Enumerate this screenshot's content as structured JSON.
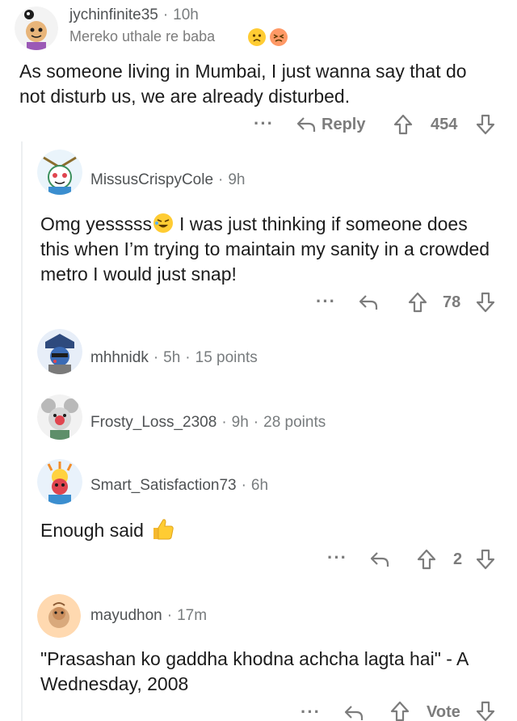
{
  "comments": [
    {
      "username": "jychinfinite35",
      "time": "10h",
      "flair": "Mereko uthale re baba",
      "body": "As someone living in Mumbai, I just wanna say that do not disturb us, we are already disturbed.",
      "reply_label": "Reply",
      "score": "454"
    },
    {
      "username": "MissusCrispyCole",
      "time": "9h",
      "body_before_emoji": "Omg yesssss",
      "body_after_emoji": "I was just thinking if someone does this when I’m trying to maintain my sanity in a crowded metro I would just snap!",
      "score": "78"
    },
    {
      "username": "mhhnidk",
      "time": "5h",
      "points": "15 points"
    },
    {
      "username": "Frosty_Loss_2308",
      "time": "9h",
      "points": "28 points"
    },
    {
      "username": "Smart_Satisfaction73",
      "time": "6h",
      "body": "Enough said",
      "score": "2"
    },
    {
      "username": "mayudhon",
      "time": "17m",
      "body": "\"Prasashan ko gaddha khodna achcha lagta hai\" - A Wednesday, 2008",
      "score": "Vote"
    }
  ],
  "separator": "·",
  "more_label": "···",
  "colors": {
    "text": "#1c1c1c",
    "meta": "#787c7e",
    "icon": "#7c7c7c",
    "thread_line": "#edeff1",
    "emoji_yellow": "#ffcc33"
  }
}
